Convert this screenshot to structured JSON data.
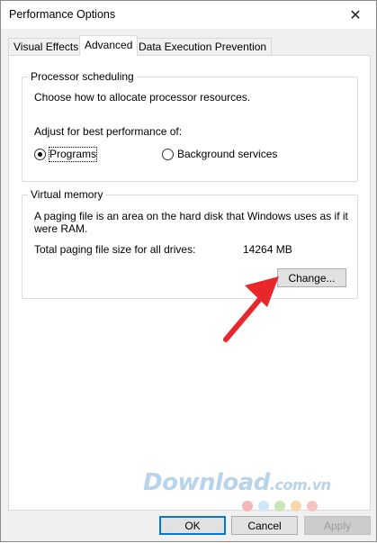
{
  "window": {
    "title": "Performance Options",
    "close_glyph": "✕"
  },
  "tabs": [
    {
      "label": "Visual Effects"
    },
    {
      "label": "Advanced"
    },
    {
      "label": "Data Execution Prevention"
    }
  ],
  "processor": {
    "group_title": "Processor scheduling",
    "description": "Choose how to allocate processor resources.",
    "adjust_label": "Adjust for best performance of:",
    "option_programs": "Programs",
    "option_background": "Background services",
    "selected": "Programs"
  },
  "virtual_memory": {
    "group_title": "Virtual memory",
    "description_line1": "A paging file is an area on the hard disk that Windows uses as if it",
    "description_line2": "were RAM.",
    "total_label": "Total paging file size for all drives:",
    "total_value": "14264 MB",
    "change_button": "Change..."
  },
  "buttons": {
    "ok": "OK",
    "cancel": "Cancel",
    "apply": "Apply"
  },
  "watermark": {
    "text": "Download",
    "suffix": ".com.vn",
    "dot_colors": [
      "#f4b6b6",
      "#cfe6f8",
      "#c9e8b8",
      "#f6d7a9",
      "#f8c3c3"
    ]
  },
  "colors": {
    "arrow": "#e8272a",
    "accent_border": "#0078d7"
  }
}
